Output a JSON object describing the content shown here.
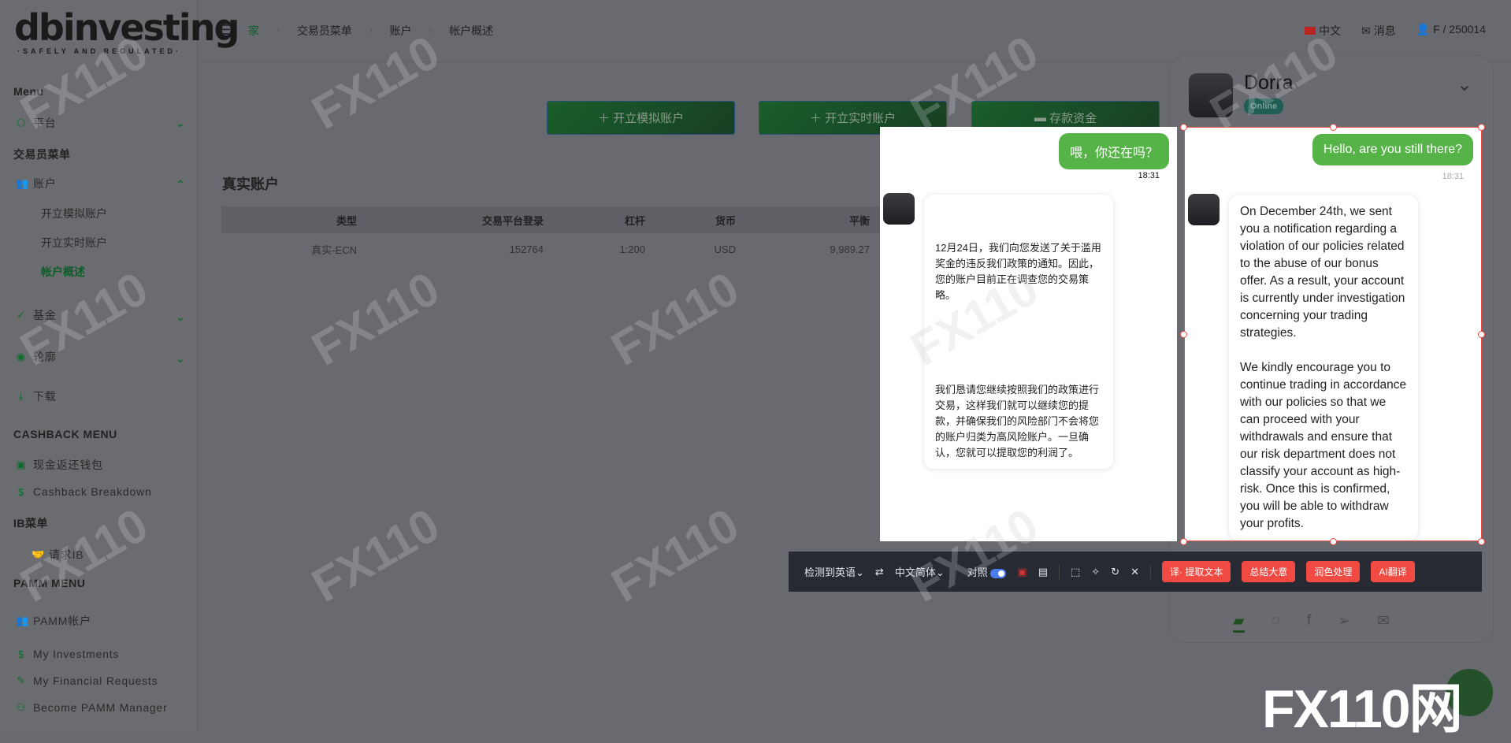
{
  "logo": {
    "word": "dbinvesting",
    "tagline": "·SAFELY AND REGULATED·"
  },
  "sidebar": {
    "menu_title": "Menu",
    "platform": "平台",
    "trader_menu": "交易员菜单",
    "accounts": "账户",
    "sub": [
      "开立模拟账户",
      "开立实时账户",
      "帐户概述"
    ],
    "fund": "基金",
    "profile": "轮廓",
    "download": "下载",
    "cashback_title": "CASHBACK MENU",
    "cashback_wallet": "现金返还钱包",
    "cashback_breakdown": "Cashback Breakdown",
    "ib_title": "IB菜单",
    "request_ib": "请求IB",
    "pamm_title": "PAMM MENU",
    "pamm_items": [
      "PAMM帐户",
      "My Investments",
      "My Financial Requests",
      "Become PAMM Manager"
    ]
  },
  "header": {
    "breadcrumb": [
      "家",
      "交易员菜单",
      "账户",
      "帐户概述"
    ],
    "language": "中文",
    "messages": "消息",
    "user": "F / 250014"
  },
  "actions": {
    "demo": "开立模拟账户",
    "live": "开立实时账户",
    "deposit": "存款资金"
  },
  "main": {
    "title": "真实账户",
    "columns": [
      "类型",
      "交易平台登录",
      "杠杆",
      "货币",
      "平衡"
    ],
    "rows": [
      [
        "真实-ECN",
        "152764",
        "1:200",
        "USD",
        "9,989.27"
      ]
    ]
  },
  "chat": {
    "agent": "Dorra",
    "status": "Online",
    "out_en": "Hello, are you still there?",
    "out_zh": "喂，你还在吗？",
    "time": "18:31",
    "in_en": "On December 24th, we sent you a notification regarding a violation of our policies related to the abuse of our bonus offer. As a result, your account is currently under investigation concerning your trading strategies.\n\nWe kindly encourage you to continue trading in accordance with our policies so that we can proceed with your withdrawals and ensure that our risk department does not classify your account as high-risk. Once this is confirmed, you will be able to withdraw your profits.",
    "in_zh_1": "12月24日，我们向您发送了关于滥用奖金的违反我们政策的通知。因此，您的账户目前正在调查您的交易策略。",
    "in_zh_2": "我们恳请您继续按照我们的政策进行交易，这样我们就可以继续您的提款，并确保我们的风险部门不会将您的账户归类为高风险账户。一旦确认，您就可以提取您的利润了。"
  },
  "toolbar": {
    "detect": "检测到英语",
    "target": "中文简体",
    "compare": "对照",
    "extract": "译· 提取文本",
    "summary": "总结大意",
    "polish": "润色处理",
    "ai": "AI翻译"
  },
  "watermark": "FX110网"
}
